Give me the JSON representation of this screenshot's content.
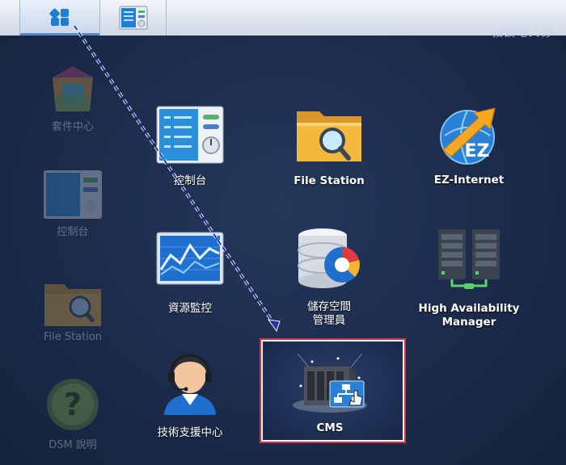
{
  "taskbar": {
    "main_menu": "main-menu",
    "control_panel": "control-panel"
  },
  "watermark": "按讚吧人毋",
  "sidebar": {
    "items": [
      {
        "label": "套件中心"
      },
      {
        "label": "控制台"
      },
      {
        "label": "File Station"
      },
      {
        "label": "DSM 說明"
      }
    ]
  },
  "apps": [
    {
      "label": "控制台"
    },
    {
      "label": "File Station"
    },
    {
      "label": "EZ-Internet"
    },
    {
      "label": "資源監控"
    },
    {
      "label": "儲存空間\n管理員"
    },
    {
      "label": "High Availability\nManager"
    },
    {
      "label": "技術支援中心"
    },
    {
      "label": "CMS"
    }
  ],
  "colors": {
    "accent": "#5a86c6",
    "highlight_border": "#e03040",
    "arrow": "#2b2ea8"
  }
}
